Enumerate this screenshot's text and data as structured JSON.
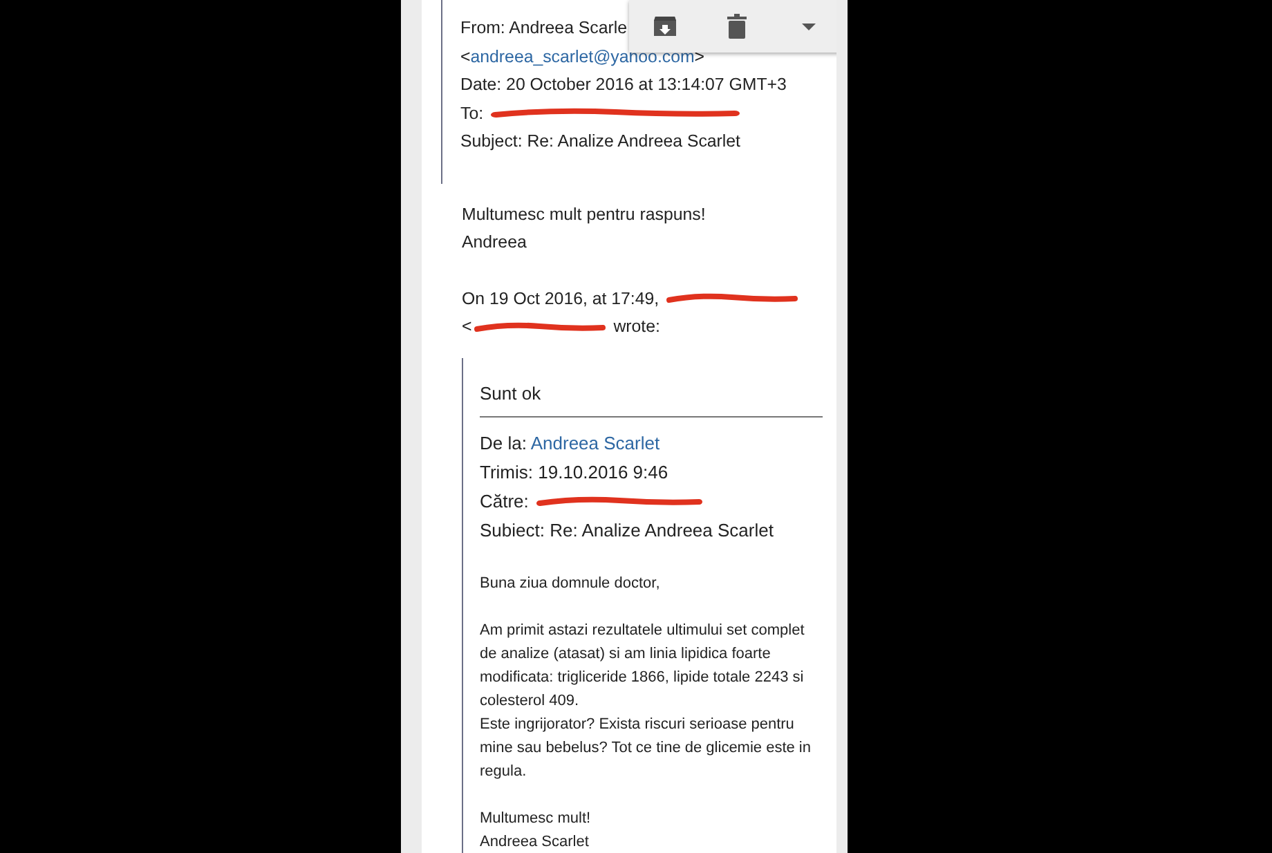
{
  "toolbar": {
    "buttons": [
      {
        "kind": "archive"
      },
      {
        "kind": "delete"
      },
      {
        "kind": "more"
      }
    ]
  },
  "forwarded_header": [
    {
      "segments": [
        {
          "kind": "text",
          "text": "From: Andreea Scarle"
        }
      ]
    },
    {
      "segments": [
        {
          "kind": "text",
          "text": "<"
        },
        {
          "kind": "link",
          "text": "andreea_scarlet@yahoo.com"
        },
        {
          "kind": "text",
          "text": ">"
        }
      ]
    },
    {
      "segments": [
        {
          "kind": "text",
          "text": "Date: 20 October 2016 at 13:14:07 GMT+3"
        }
      ]
    },
    {
      "segments": [
        {
          "kind": "text",
          "text": "To: "
        },
        {
          "kind": "redacted"
        }
      ]
    },
    {
      "segments": [
        {
          "kind": "text",
          "text": "Subject: Re: Analize Andreea Scarlet"
        }
      ]
    }
  ],
  "message": [
    {
      "segments": [
        {
          "kind": "text",
          "text": "Multumesc mult pentru raspuns!"
        }
      ]
    },
    {
      "segments": [
        {
          "kind": "text",
          "text": "Andreea"
        }
      ]
    }
  ],
  "attribution": [
    {
      "segments": [
        {
          "kind": "text",
          "text": "On 19 Oct 2016, at 17:49, "
        },
        {
          "kind": "redacted"
        }
      ]
    },
    {
      "segments": [
        {
          "kind": "text",
          "text": "<"
        },
        {
          "kind": "redacted"
        },
        {
          "kind": "text",
          "text": " wrote:"
        }
      ]
    }
  ],
  "quote": {
    "title": "Sunt ok",
    "header": [
      {
        "segments": [
          {
            "kind": "text",
            "text": "De la: "
          },
          {
            "kind": "link",
            "text": "Andreea Scarlet"
          }
        ]
      },
      {
        "segments": [
          {
            "kind": "text",
            "text": "Trimis: 19.10.2016 9:46"
          }
        ]
      },
      {
        "segments": [
          {
            "kind": "text",
            "text": "Către: "
          },
          {
            "kind": "redacted"
          }
        ]
      },
      {
        "segments": [
          {
            "kind": "text",
            "text": "Subiect: Re: Analize Andreea Scarlet"
          }
        ]
      }
    ],
    "body": [
      {
        "lines": [
          "Buna ziua domnule doctor,"
        ]
      },
      {
        "lines": [
          "Am primit astazi rezultatele ultimului set complet de analize (atasat) si am linia lipidica foarte modificata: trigliceride 1866, lipide totale 2243 si colesterol 409.",
          "Este ingrijorator? Exista riscuri serioase pentru mine sau bebelus? Tot ce tine de glicemie este in regula."
        ]
      },
      {
        "lines": [
          "Multumesc mult!",
          "Andreea Scarlet"
        ]
      }
    ]
  }
}
